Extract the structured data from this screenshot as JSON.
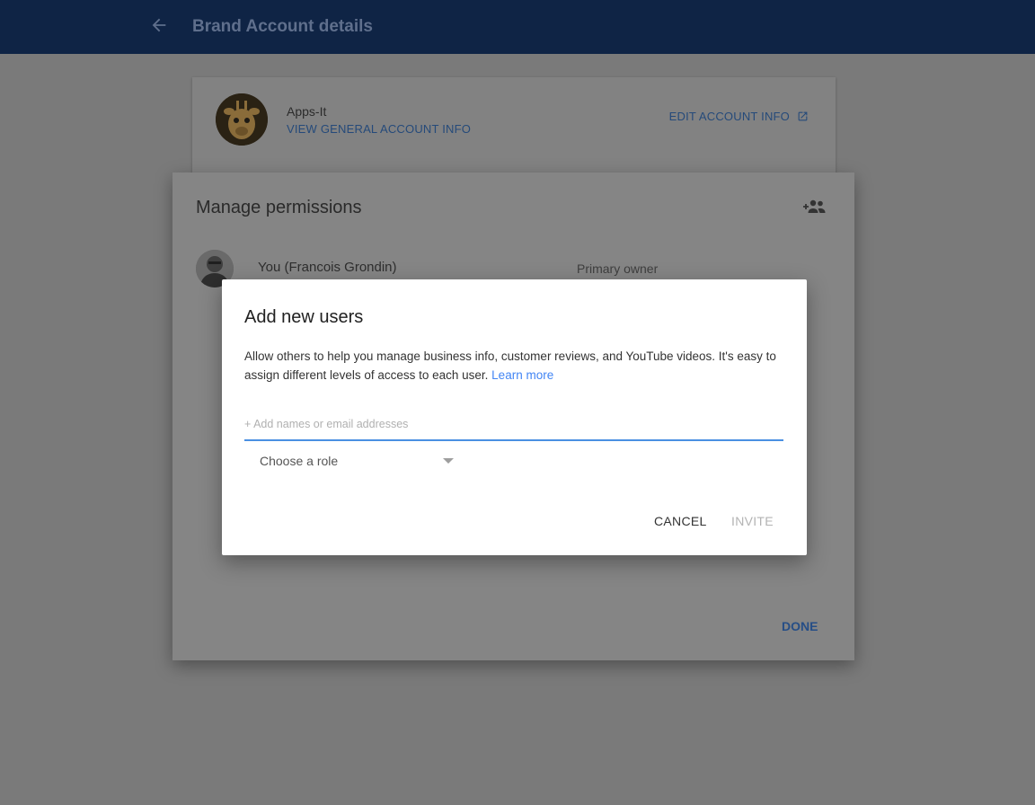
{
  "header": {
    "title": "Brand Account details",
    "back_icon": "arrow-left-icon"
  },
  "account": {
    "name": "Apps-It",
    "view_link": "VIEW GENERAL ACCOUNT INFO",
    "edit_link": "EDIT ACCOUNT INFO",
    "edit_icon": "open-in-new-icon"
  },
  "manage": {
    "title": "Manage permissions",
    "add_icon": "add-people-icon",
    "user": {
      "name": "You (Francois Grondin)",
      "role": "Primary owner"
    },
    "done_label": "DONE"
  },
  "add_users": {
    "title": "Add new users",
    "description": "Allow others to help you manage business info, customer reviews, and YouTube videos. It's easy to assign different levels of access to each user.",
    "learn_more": "Learn more",
    "input_placeholder": "+ Add names or email addresses",
    "input_value": "",
    "role_select": "Choose a role",
    "cancel_label": "CANCEL",
    "invite_label": "INVITE"
  },
  "colors": {
    "header_bg": "#0f2445",
    "overlay": "#7a7a7a",
    "accent": "#4285f4",
    "link_dim": "#254a7a"
  }
}
